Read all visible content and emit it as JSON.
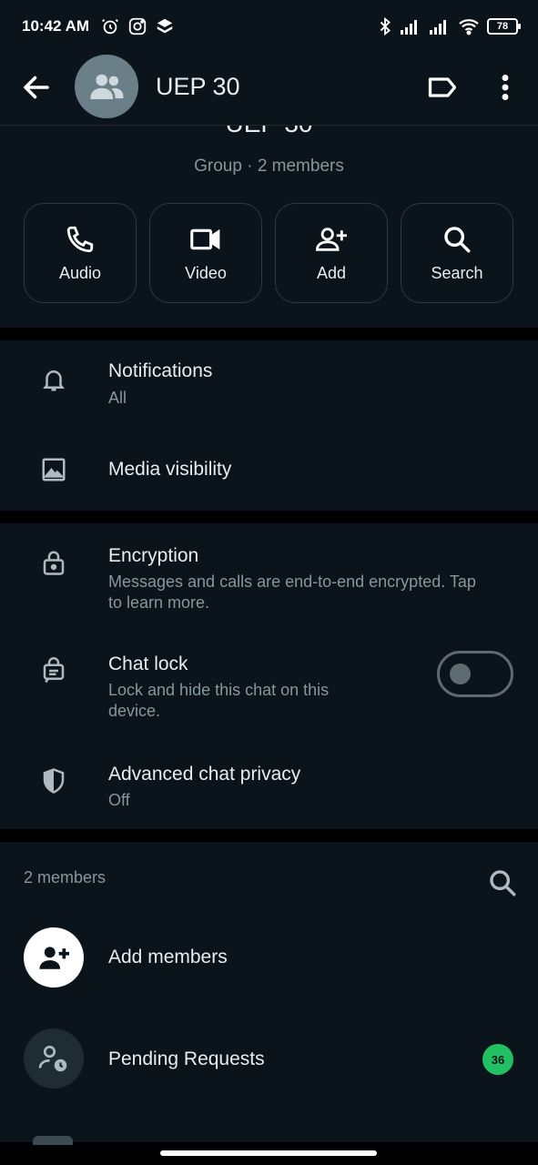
{
  "status_bar": {
    "time": "10:42 AM",
    "battery": "78"
  },
  "header": {
    "title": "UEP 30"
  },
  "profile": {
    "name": "UEP 30",
    "subtitle": "Group · 2 members"
  },
  "actions": [
    {
      "label": "Audio",
      "icon": "phone-icon"
    },
    {
      "label": "Video",
      "icon": "video-icon"
    },
    {
      "label": "Add",
      "icon": "add-person-icon"
    },
    {
      "label": "Search",
      "icon": "search-icon"
    }
  ],
  "settings": {
    "notifications": {
      "title": "Notifications",
      "value": "All"
    },
    "media_visibility": {
      "title": "Media visibility"
    },
    "encryption": {
      "title": "Encryption",
      "description": "Messages and calls are end-to-end encrypted. Tap to learn more."
    },
    "chat_lock": {
      "title": "Chat lock",
      "description": "Lock and hide this chat on this device.",
      "enabled": false
    },
    "advanced_privacy": {
      "title": "Advanced chat privacy",
      "value": "Off"
    }
  },
  "members": {
    "count_label": "2 members",
    "add_label": "Add members",
    "pending_label": "Pending Requests",
    "pending_count": "36"
  },
  "colors": {
    "background": "#0b141a",
    "accent": "#21c063",
    "muted": "#8696a0"
  }
}
